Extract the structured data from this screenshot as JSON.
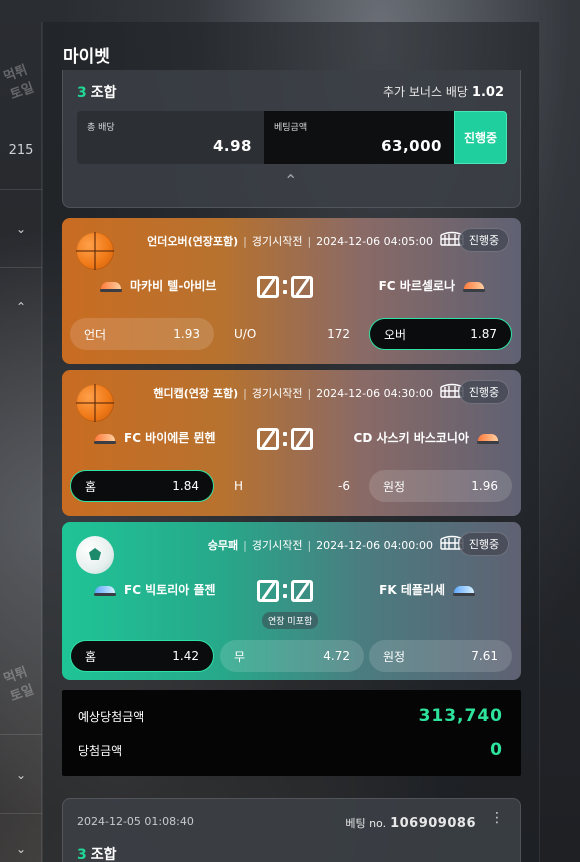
{
  "page": {
    "title": "마이벳"
  },
  "left_rail": {
    "number": "215",
    "watermark": "먹튀토일"
  },
  "summary": {
    "combo_count": "3",
    "combo_label": "조합",
    "bonus_label": "추가 보너스 배당",
    "bonus_value": "1.02",
    "total_odds_label": "총 배당",
    "total_odds": "4.98",
    "bet_amount_label": "베팅금액",
    "bet_amount": "63,000",
    "status": "진행중"
  },
  "matches": [
    {
      "sport_icon": "basketball-icon",
      "market": "언더오버(연장포함)",
      "state": "경기시작전",
      "datetime": "2024-12-06 04:05:00",
      "status": "진행중",
      "home": "마카비 텔-아비브",
      "away": "FC 바르셀로나",
      "score_home": "0",
      "score_away": "0",
      "options": [
        {
          "label": "언더",
          "odds": "1.93",
          "selected": false
        },
        {
          "label": "U/O",
          "odds": "172",
          "selected": false
        },
        {
          "label": "오버",
          "odds": "1.87",
          "selected": true
        }
      ]
    },
    {
      "sport_icon": "basketball-icon",
      "market": "핸디캡(연장 포함)",
      "state": "경기시작전",
      "datetime": "2024-12-06 04:30:00",
      "status": "진행중",
      "home": "FC 바이에른 뮌헨",
      "away": "CD 사스키 바스코니아",
      "score_home": "0",
      "score_away": "0",
      "options": [
        {
          "label": "홈",
          "odds": "1.84",
          "selected": true
        },
        {
          "label": "H",
          "odds": "-6",
          "selected": false
        },
        {
          "label": "원정",
          "odds": "1.96",
          "selected": false
        }
      ]
    },
    {
      "sport_icon": "soccer-ball-icon",
      "market": "승무패",
      "state": "경기시작전",
      "datetime": "2024-12-06 04:00:00",
      "status": "진행중",
      "home": "FC 빅토리아 플젠",
      "away": "FK 테플리세",
      "score_home": "0",
      "score_away": "0",
      "note": "연장 미포함",
      "options": [
        {
          "label": "홈",
          "odds": "1.42",
          "selected": true
        },
        {
          "label": "무",
          "odds": "4.72",
          "selected": false
        },
        {
          "label": "원정",
          "odds": "7.61",
          "selected": false
        }
      ]
    }
  ],
  "result": {
    "expected_label": "예상당첨금액",
    "expected_value": "313,740",
    "win_label": "당첨금액",
    "win_value": "0"
  },
  "next_bet": {
    "datetime": "2024-12-05 01:08:40",
    "bet_no_label": "베팅 no.",
    "bet_no": "106909086",
    "combo_count": "3",
    "combo_label": "조합"
  },
  "colors": {
    "accent": "#20d796",
    "orange_card": "#c96c22",
    "green_card": "#1fc496"
  }
}
